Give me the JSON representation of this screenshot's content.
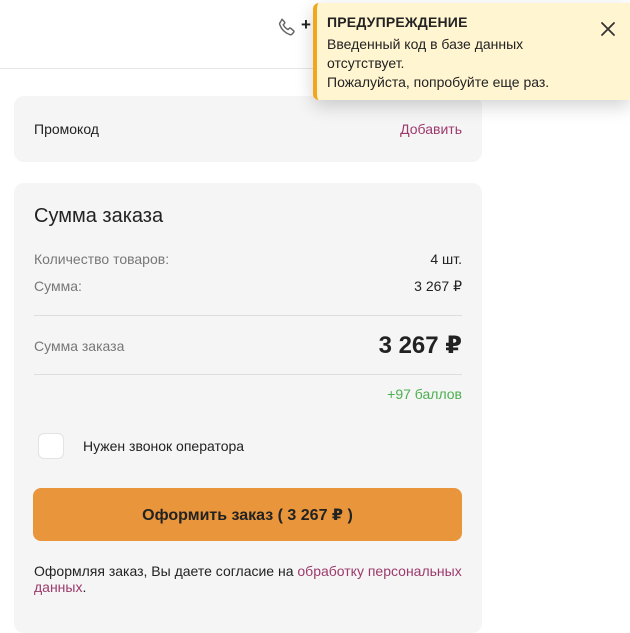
{
  "header": {
    "phone_icon": "phone-icon",
    "phone_prefix": "+"
  },
  "toast": {
    "title": "ПРЕДУПРЕЖДЕНИЕ",
    "message_lines": [
      "Введенный код в базе данных",
      "отсутствует.",
      "Пожалуйста, попробуйте еще раз."
    ],
    "close_icon": "close-icon",
    "accent_color": "#f0a71e",
    "background_color": "#fff5d1"
  },
  "promo": {
    "label": "Промокод",
    "add_label": "Добавить"
  },
  "summary": {
    "title": "Сумма заказа",
    "qty_label": "Количество товаров:",
    "qty_value": "4 шт.",
    "sum_label": "Сумма:",
    "sum_value": "3 267 ₽",
    "total_label": "Сумма заказа",
    "total_value": "3 267 ₽",
    "bonus": "+97 баллов",
    "operator_call_label": "Нужен звонок оператора",
    "operator_call_checked": false,
    "order_button_label": "Оформить заказ ( 3 267 ₽ )",
    "consent_text": "Оформляя заказ, Вы даете согласие на ",
    "consent_link": "обработку персональных данных",
    "consent_end": "."
  },
  "colors": {
    "order_button": "#e9953b",
    "link": "#9c3a6c",
    "bonus": "#4caf50",
    "card_background": "#f5f5f5"
  }
}
